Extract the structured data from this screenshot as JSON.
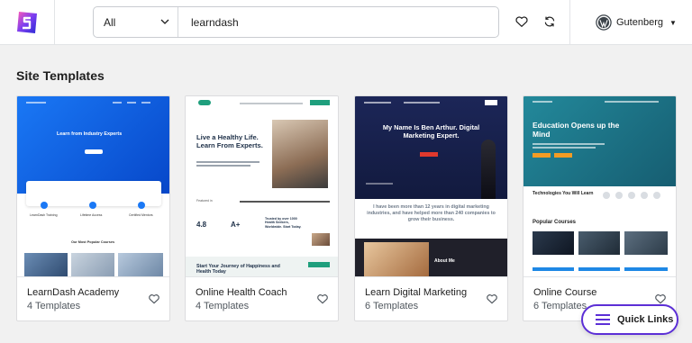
{
  "header": {
    "logo_icon": "starter-templates-logo-icon",
    "category_selected": "All",
    "search_value": "learndash",
    "favorites_icon": "heart-icon",
    "sync_icon": "sync-icon",
    "builder_label": "Gutenberg",
    "builder_icon": "wordpress-icon"
  },
  "section": {
    "title": "Site Templates"
  },
  "cards": [
    {
      "title": "LearnDash Academy",
      "count": "4 Templates",
      "hero_text": "Learn from Industry Experts",
      "features": [
        "LearnDash Training",
        "Lifetime Access",
        "Certified Mentors"
      ],
      "section_text": "Our Most Popular Courses"
    },
    {
      "title": "Online Health Coach",
      "count": "4 Templates",
      "hero_text": "Live a Healthy Life. Learn From Experts.",
      "stats": [
        "4.8",
        "A+"
      ],
      "featured_label": "Featured in",
      "side_text": "Trusted by over 1000 Health Seekers, Worldwide. Start Today.",
      "bottom_text": "Start Your Journey of Happiness and Health Today"
    },
    {
      "title": "Learn Digital Marketing",
      "count": "6 Templates",
      "hero_text": "My Name Is Ben Arthur. Digital Marketing Expert.",
      "body_text": "I have been more than 12 years in digital marketing industries, and have helped more than 240 companies to grow their business.",
      "about_text": "About Me"
    },
    {
      "title": "Online Course",
      "count": "6 Templates",
      "hero_text": "Education Opens up the Mind",
      "tech_text": "Technologies You Will Learn",
      "popular_text": "Popular Courses"
    }
  ],
  "quick_links": {
    "label": "Quick Links",
    "icon": "menu-icon"
  },
  "colors": {
    "accent": "#5c2fd6",
    "learndash_blue": "#0b67f2",
    "health_green": "#1f9f7d",
    "marketing_navy": "#17224a",
    "online_teal": "#1e7f91",
    "online_orange": "#f39c24"
  }
}
